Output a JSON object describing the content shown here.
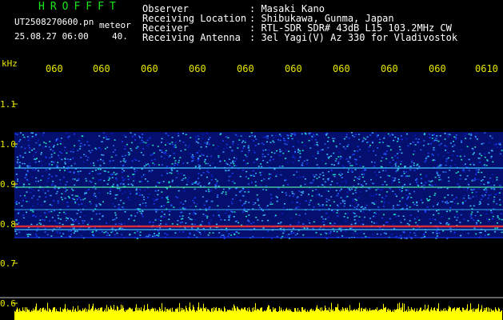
{
  "app_title": "HROFFFT",
  "file": {
    "name": "UT2508270600.pn",
    "ext": "meteor",
    "datetime": "25.08.27 06:00",
    "gain": "40."
  },
  "header": [
    {
      "label": "Observer",
      "value": ": Masaki Kano"
    },
    {
      "label": "Receiving Location",
      "value": ": Shibukawa, Gunma, Japan"
    },
    {
      "label": "Receiver",
      "value": ": RTL-SDR SDR# 43dB L15 103.2MHz CW"
    },
    {
      "label": "Receiving Antenna",
      "value": ": 3el Yagi(V) Az 330 for Vladivostok"
    }
  ],
  "axis": {
    "y_unit": "kHz",
    "y_ticks": [
      "1.1",
      "1.0",
      "0.9",
      "0.8",
      "0.7",
      "0.6"
    ],
    "x_ticks": [
      "060",
      "060",
      "060",
      "060",
      "060",
      "060",
      "060",
      "060",
      "060",
      "0610"
    ]
  },
  "colors": {
    "axis_text": "#e6e600",
    "title_green": "#19e619",
    "noise_base": "#0a1ec8",
    "noise_bright": "#3cc8ff",
    "signal_hot": "#ff3030",
    "level_bar": "#ffff00"
  }
}
